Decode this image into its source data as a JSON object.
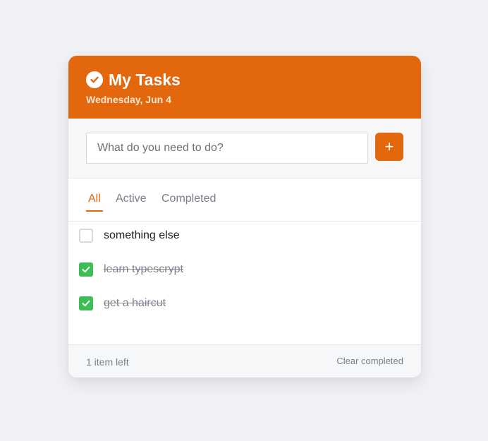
{
  "header": {
    "title": "My Tasks",
    "date": "Wednesday, Jun 4",
    "icon": "check-circle-icon"
  },
  "add_task": {
    "placeholder": "What do you need to do?",
    "value": "",
    "button_label": "+"
  },
  "tabs": [
    {
      "label": "All",
      "active": true
    },
    {
      "label": "Active",
      "active": false
    },
    {
      "label": "Completed",
      "active": false
    }
  ],
  "tasks": [
    {
      "text": "something else",
      "completed": false
    },
    {
      "text": "learn typescrypt",
      "completed": true
    },
    {
      "text": "get a haircut",
      "completed": true
    }
  ],
  "footer": {
    "items_left": "1 item left",
    "clear_label": "Clear completed"
  },
  "colors": {
    "accent": "#e2670d",
    "checked": "#3dbd55",
    "background": "#f0f2f5"
  }
}
